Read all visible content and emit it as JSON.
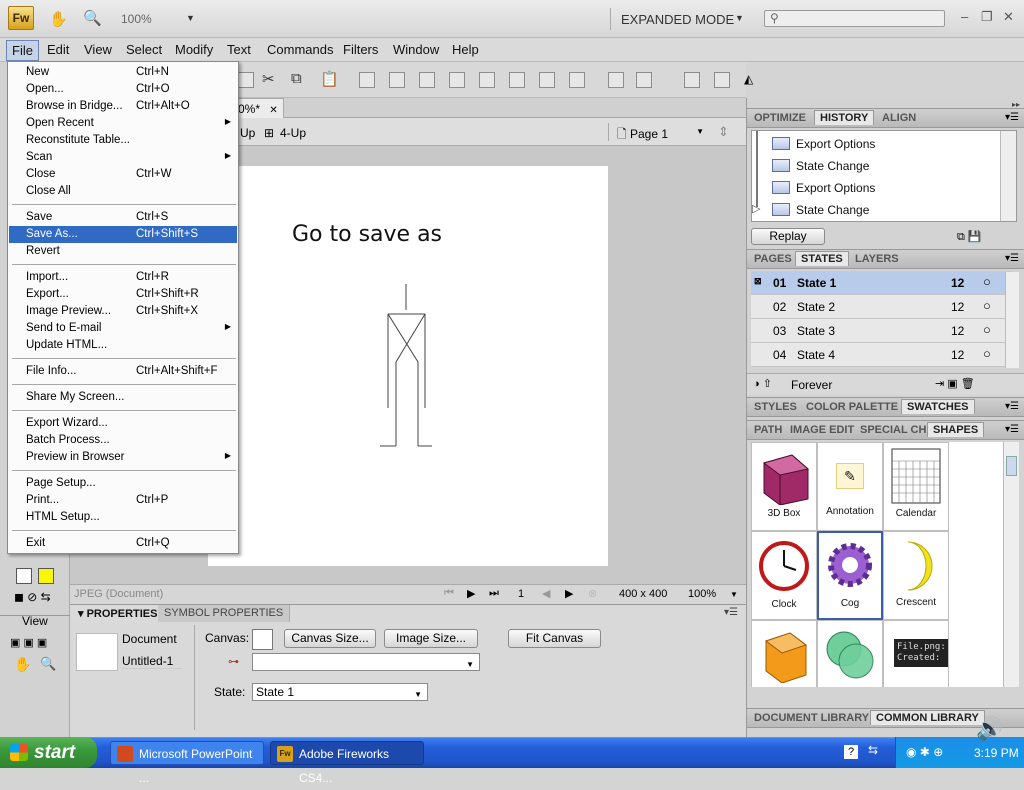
{
  "app": {
    "logo": "Fw",
    "zoom": "100%",
    "mode": "EXPANDED MODE",
    "search_placeholder": ""
  },
  "menubar": [
    "File",
    "Edit",
    "View",
    "Select",
    "Modify",
    "Text",
    "Commands",
    "Filters",
    "Window",
    "Help"
  ],
  "file_menu": [
    {
      "label": "New",
      "shortcut": "Ctrl+N"
    },
    {
      "label": "Open...",
      "shortcut": "Ctrl+O"
    },
    {
      "label": "Browse in Bridge...",
      "shortcut": "Ctrl+Alt+O"
    },
    {
      "label": "Open Recent",
      "shortcut": "",
      "submenu": true
    },
    {
      "label": "Reconstitute Table...",
      "shortcut": ""
    },
    {
      "label": "Scan",
      "shortcut": "",
      "submenu": true
    },
    {
      "label": "Close",
      "shortcut": "Ctrl+W"
    },
    {
      "label": "Close All",
      "shortcut": ""
    },
    {
      "label": "Save",
      "shortcut": "Ctrl+S"
    },
    {
      "label": "Save As...",
      "shortcut": "Ctrl+Shift+S",
      "highlighted": true
    },
    {
      "label": "Revert",
      "shortcut": ""
    },
    {
      "label": "Import...",
      "shortcut": "Ctrl+R"
    },
    {
      "label": "Export...",
      "shortcut": "Ctrl+Shift+R"
    },
    {
      "label": "Image Preview...",
      "shortcut": "Ctrl+Shift+X"
    },
    {
      "label": "Send to E-mail",
      "shortcut": "",
      "submenu": true
    },
    {
      "label": "Update HTML...",
      "shortcut": ""
    },
    {
      "label": "File Info...",
      "shortcut": "Ctrl+Alt+Shift+F"
    },
    {
      "label": "Share My Screen...",
      "shortcut": ""
    },
    {
      "label": "Export Wizard...",
      "shortcut": ""
    },
    {
      "label": "Batch Process...",
      "shortcut": ""
    },
    {
      "label": "Preview in Browser",
      "shortcut": "",
      "submenu": true
    },
    {
      "label": "Page Setup...",
      "shortcut": ""
    },
    {
      "label": "Print...",
      "shortcut": "Ctrl+P"
    },
    {
      "label": "HTML Setup...",
      "shortcut": ""
    },
    {
      "label": "Exit",
      "shortcut": "Ctrl+Q"
    }
  ],
  "document": {
    "tab_label": "0%*",
    "view_labels": [
      "Up",
      "4-Up"
    ],
    "page_select": "Page 1",
    "canvas_text": "Go to save as",
    "status_left": "JPEG (Document)",
    "frame_num": "1",
    "canvas_size": "400 x 400",
    "zoom": "100%"
  },
  "properties": {
    "tabs": [
      "PROPERTIES",
      "SYMBOL PROPERTIES"
    ],
    "doc_type": "Document",
    "doc_name": "Untitled-1",
    "canvas_label": "Canvas:",
    "btn_canvas_size": "Canvas Size...",
    "btn_image_size": "Image Size...",
    "btn_fit_canvas": "Fit Canvas",
    "state_label": "State:",
    "state_value": "State 1"
  },
  "left_tools": {
    "view_label": "View"
  },
  "right": {
    "history_tabs": [
      "OPTIMIZE",
      "HISTORY",
      "ALIGN"
    ],
    "history_items": [
      "Export Options",
      "State Change",
      "Export Options",
      "State Change"
    ],
    "replay": "Replay",
    "states_tabs": [
      "PAGES",
      "STATES",
      "LAYERS"
    ],
    "states": [
      {
        "num": "01",
        "name": "State 1",
        "delay": "12"
      },
      {
        "num": "02",
        "name": "State 2",
        "delay": "12"
      },
      {
        "num": "03",
        "name": "State 3",
        "delay": "12"
      },
      {
        "num": "04",
        "name": "State 4",
        "delay": "12"
      }
    ],
    "loop": "Forever",
    "swatch_tabs": [
      "STYLES",
      "COLOR PALETTE",
      "SWATCHES"
    ],
    "shapes_tabs": [
      "PATH",
      "IMAGE EDIT",
      "SPECIAL CH",
      "SHAPES"
    ],
    "shapes": [
      "3D Box",
      "Annotation",
      "Calendar",
      "Clock",
      "Cog",
      "Crescent"
    ],
    "file_png_text": "File.png:\nCreated:",
    "library_tabs": [
      "DOCUMENT LIBRARY",
      "COMMON LIBRARY"
    ]
  },
  "taskbar": {
    "start": "start",
    "items": [
      "Microsoft PowerPoint ...",
      "Adobe Fireworks CS4..."
    ],
    "clock": "3:19 PM"
  }
}
